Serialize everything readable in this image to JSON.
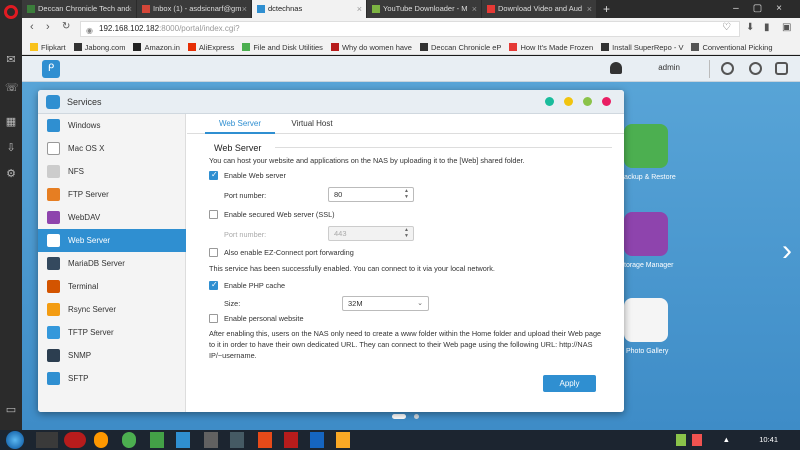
{
  "browser": {
    "tabs": [
      {
        "title": "Deccan Chronicle Tech and",
        "color": "#3b7d3b",
        "active": false
      },
      {
        "title": "Inbox (1) - asdsicnarf@gm",
        "color": "#d44638",
        "active": false
      },
      {
        "title": "dctechnas",
        "color": "#2f8fd1",
        "active": true
      },
      {
        "title": "YouTube Downloader - M",
        "color": "#7cb342",
        "active": false
      },
      {
        "title": "Download Video and Aud",
        "color": "#e53935",
        "active": false
      }
    ],
    "new_tab": "+",
    "url_host": "192.168.102.182",
    "url_path": ":8000/portal/index.cgi?",
    "bookmarks": [
      {
        "label": "Flipkart",
        "color": "#f9c21b"
      },
      {
        "label": "Jabong.com",
        "color": "#333333"
      },
      {
        "label": "Amazon.in",
        "color": "#222222"
      },
      {
        "label": "AliExpress",
        "color": "#e62e04"
      },
      {
        "label": "File and Disk Utilities",
        "color": "#4caf50"
      },
      {
        "label": "Why do women have",
        "color": "#b71c1c"
      },
      {
        "label": "Deccan Chronicle eP",
        "color": "#333333"
      },
      {
        "label": "How It's Made Frozen",
        "color": "#e53935"
      },
      {
        "label": "Install SuperRepo - V",
        "color": "#333333"
      },
      {
        "label": "Conventional Picking",
        "color": "#555555"
      }
    ]
  },
  "nas": {
    "user": "admin",
    "desktop_apps": [
      {
        "label": "ackup & Restore",
        "color": "#4caf50"
      },
      {
        "label": "torage Manager",
        "color": "#8e44ad"
      },
      {
        "label": "Photo Gallery",
        "color": "#f5f5f5"
      }
    ]
  },
  "window": {
    "title": "Services",
    "controls": [
      "#1abc9c",
      "#f1c40f",
      "#8bc34a",
      "#e91e63"
    ],
    "sidebar": [
      {
        "label": "Windows",
        "color": "#2f8fd1",
        "active": false
      },
      {
        "label": "Mac OS X",
        "color": "#999999",
        "active": false
      },
      {
        "label": "NFS",
        "color": "#888888",
        "active": false
      },
      {
        "label": "FTP Server",
        "color": "#e67e22",
        "active": false
      },
      {
        "label": "WebDAV",
        "color": "#8e44ad",
        "active": false
      },
      {
        "label": "Web Server",
        "color": "#ffffff",
        "active": true
      },
      {
        "label": "MariaDB Server",
        "color": "#34495e",
        "active": false
      },
      {
        "label": "Terminal",
        "color": "#d35400",
        "active": false
      },
      {
        "label": "Rsync Server",
        "color": "#f39c12",
        "active": false
      },
      {
        "label": "TFTP Server",
        "color": "#3498db",
        "active": false
      },
      {
        "label": "SNMP",
        "color": "#2c3e50",
        "active": false
      },
      {
        "label": "SFTP",
        "color": "#2f8fd1",
        "active": false
      }
    ],
    "tabs": [
      {
        "label": "Web Server",
        "active": true
      },
      {
        "label": "Virtual Host",
        "active": false
      }
    ],
    "section_title": "Web Server",
    "intro": "You can host your website and applications on the NAS by uploading it to the [Web] shared folder.",
    "enable_web": {
      "label": "Enable Web server",
      "checked": true
    },
    "port_label": "Port number:",
    "port_value": "80",
    "enable_ssl": {
      "label": "Enable secured Web server (SSL)",
      "checked": false
    },
    "ssl_port_label": "Port number:",
    "ssl_port_value": "443",
    "ezconnect": {
      "label": "Also enable EZ-Connect port forwarding",
      "checked": false
    },
    "status_msg": "This service has been successfully enabled. You can connect to it via your local network.",
    "php_cache": {
      "label": "Enable PHP cache",
      "checked": true
    },
    "size_label": "Size:",
    "size_value": "32M",
    "personal_site": {
      "label": "Enable personal website",
      "checked": false
    },
    "personal_desc": "After enabling this, users on the NAS only need to create a www folder within the Home folder and upload their Web page to it in order to have their own dedicated URL. They can connect to their Web page using the following URL: http://NAS IP/~username.",
    "apply_label": "Apply"
  },
  "taskbar": {
    "time": "10:41",
    "items": [
      "#d32f2f",
      "#ffb300",
      "#4caf50",
      "#43a047",
      "#2f8fd1",
      "#616161",
      "#455a64",
      "#e64a19",
      "#b71c1c",
      "#1565c0",
      "#f9a825",
      "#8bc34a",
      "#ef5350"
    ]
  }
}
